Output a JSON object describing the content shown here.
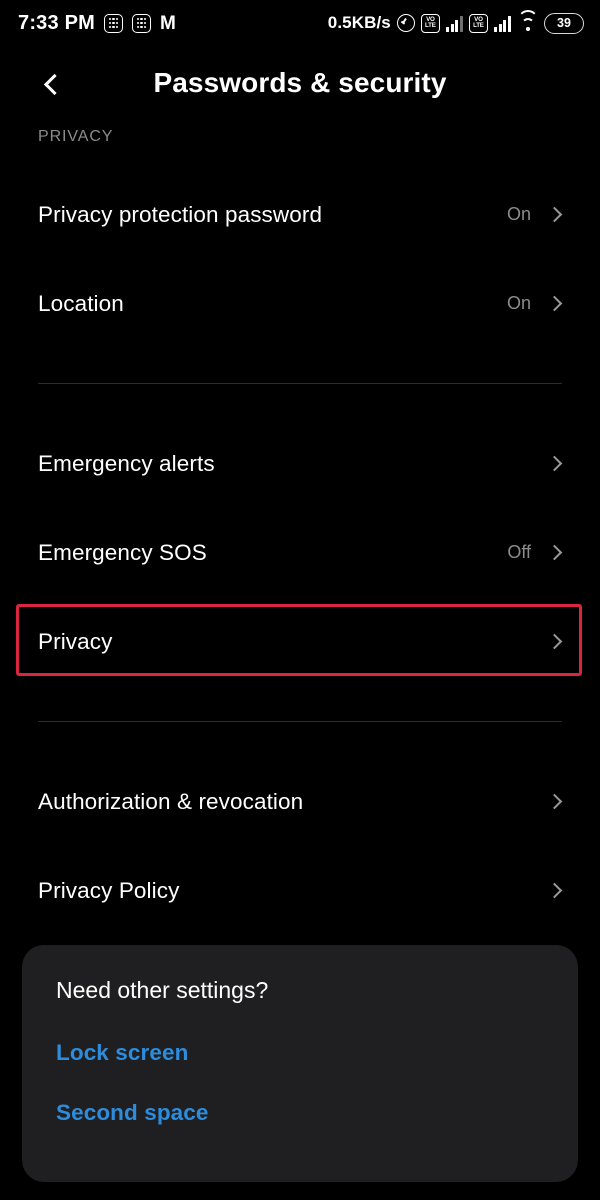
{
  "status_bar": {
    "time": "7:33 PM",
    "network_speed": "0.5KB/s",
    "battery_level": "39",
    "left_icons": [
      "sim-card-1-icon",
      "sim-card-2-icon",
      "mi-logo-icon"
    ],
    "right_icons": [
      "alarm-icon",
      "volte-1-icon",
      "signal-1-icon",
      "volte-2-icon",
      "signal-2-icon",
      "wifi-icon",
      "battery-icon"
    ],
    "volte_top": "VO",
    "volte_bottom": "LTE"
  },
  "header": {
    "title": "Passwords & security",
    "back_icon": "chevron-left-icon"
  },
  "section": {
    "label": "PRIVACY"
  },
  "list": {
    "groups": [
      {
        "items": [
          {
            "label": "Privacy protection password",
            "value": "On"
          },
          {
            "label": "Location",
            "value": "On"
          }
        ]
      },
      {
        "items": [
          {
            "label": "Emergency alerts",
            "value": ""
          },
          {
            "label": "Emergency SOS",
            "value": "Off"
          },
          {
            "label": "Privacy",
            "value": ""
          }
        ]
      },
      {
        "items": [
          {
            "label": "Authorization & revocation",
            "value": ""
          },
          {
            "label": "Privacy Policy",
            "value": ""
          }
        ]
      }
    ]
  },
  "highlight": {
    "target": "Privacy",
    "color": "#d9253f"
  },
  "card": {
    "title": "Need other settings?",
    "links": [
      "Lock screen",
      "Second space"
    ],
    "link_color": "#2d8cdb",
    "background": "#1f1f21"
  }
}
